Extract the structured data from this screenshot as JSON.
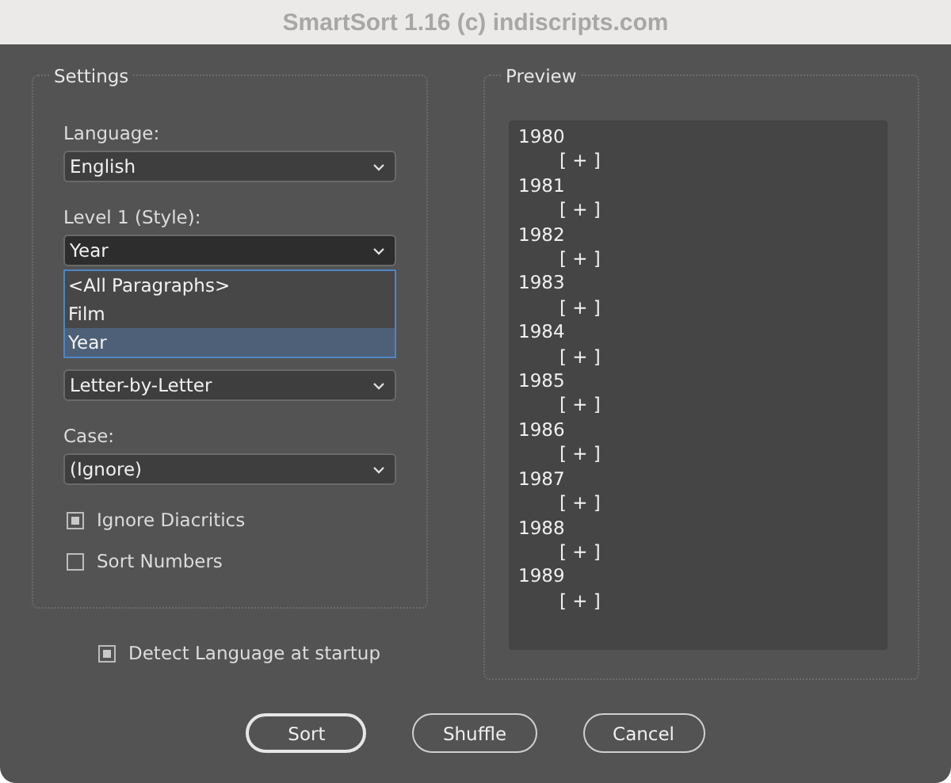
{
  "window": {
    "title": "SmartSort 1.16  (c) indiscripts.com"
  },
  "settings": {
    "legend": "Settings",
    "fields": [
      {
        "label": "Language:",
        "value": "English",
        "open": false
      },
      {
        "label": "Level 1 (Style):",
        "value": "Year",
        "open": true,
        "options": [
          {
            "label": "<All Paragraphs>",
            "selected": false
          },
          {
            "label": "Film",
            "selected": false
          },
          {
            "label": "Year",
            "selected": true
          }
        ]
      },
      {
        "value": "Letter-by-Letter",
        "open": false
      },
      {
        "label": "Case:",
        "value": "(Ignore)",
        "open": false
      }
    ],
    "checkboxes": [
      {
        "label": "Ignore Diacritics",
        "checked": true
      },
      {
        "label": "Sort Numbers",
        "checked": false
      }
    ]
  },
  "detect": {
    "label": "Detect Language at startup",
    "checked": true
  },
  "preview": {
    "legend": "Preview",
    "lines": [
      {
        "text": "1980",
        "children": [
          {
            "text": "[ + ]"
          }
        ]
      },
      {
        "text": "1981",
        "children": [
          {
            "text": "[ + ]"
          }
        ]
      },
      {
        "text": "1982",
        "children": [
          {
            "text": "[ + ]"
          }
        ]
      },
      {
        "text": "1983",
        "children": [
          {
            "text": "[ + ]"
          }
        ]
      },
      {
        "text": "1984",
        "children": [
          {
            "text": "[ + ]"
          }
        ]
      },
      {
        "text": "1985",
        "children": [
          {
            "text": "[ + ]"
          }
        ]
      },
      {
        "text": "1986",
        "children": [
          {
            "text": "[ + ]"
          }
        ]
      },
      {
        "text": "1987",
        "children": [
          {
            "text": "[ + ]"
          }
        ]
      },
      {
        "text": "1988",
        "children": [
          {
            "text": "[ + ]"
          }
        ]
      },
      {
        "text": "1989",
        "children": [
          {
            "text": "[ + ]"
          }
        ]
      }
    ]
  },
  "buttons": [
    "Sort",
    "Shuffle",
    "Cancel"
  ]
}
